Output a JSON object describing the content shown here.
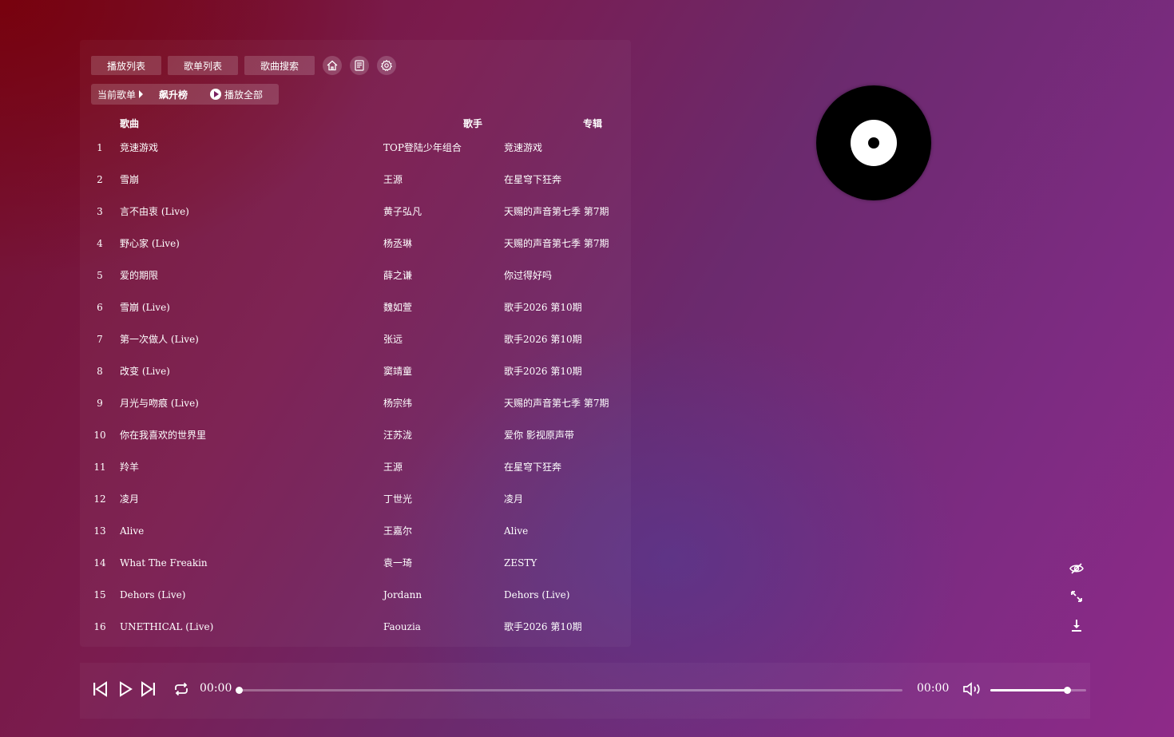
{
  "nav": {
    "tabs": [
      {
        "label": "播放列表",
        "icon": ""
      },
      {
        "label": "歌单列表",
        "icon": ""
      },
      {
        "label": "歌曲搜索",
        "icon": ""
      }
    ],
    "icon_buttons": [
      "home-icon",
      "document-icon",
      "settings-icon"
    ]
  },
  "subbar": {
    "current_label": "当前歌单",
    "list_name": "飙升榜",
    "play_all_label": "播放全部"
  },
  "table": {
    "headers": {
      "song": "歌曲",
      "artist": "歌手",
      "album": "专辑"
    },
    "rows": [
      {
        "num": "1",
        "song": "竞速游戏",
        "artist": "TOP登陆少年组合",
        "album": "竞速游戏"
      },
      {
        "num": "2",
        "song": "雪崩",
        "artist": "王源",
        "album": "在星穹下狂奔"
      },
      {
        "num": "3",
        "song": "言不由衷 (Live)",
        "artist": "黄子弘凡",
        "album": "天赐的声音第七季 第7期"
      },
      {
        "num": "4",
        "song": "野心家 (Live)",
        "artist": "杨丞琳",
        "album": "天赐的声音第七季 第7期"
      },
      {
        "num": "5",
        "song": "爱的期限",
        "artist": "薛之谦",
        "album": "你过得好吗"
      },
      {
        "num": "6",
        "song": "雪崩 (Live)",
        "artist": "魏如萱",
        "album": "歌手2026 第10期"
      },
      {
        "num": "7",
        "song": "第一次做人 (Live)",
        "artist": "张远",
        "album": "歌手2026 第10期"
      },
      {
        "num": "8",
        "song": "改变 (Live)",
        "artist": "窦靖童",
        "album": "歌手2026 第10期"
      },
      {
        "num": "9",
        "song": "月光与吻痕 (Live)",
        "artist": "杨宗纬",
        "album": "天赐的声音第七季 第7期"
      },
      {
        "num": "10",
        "song": "你在我喜欢的世界里",
        "artist": "汪苏泷",
        "album": "爱你 影视原声带"
      },
      {
        "num": "11",
        "song": "羚羊",
        "artist": "王源",
        "album": "在星穹下狂奔"
      },
      {
        "num": "12",
        "song": "凌月",
        "artist": "丁世光",
        "album": "凌月"
      },
      {
        "num": "13",
        "song": "Alive",
        "artist": "王嘉尔",
        "album": "Alive"
      },
      {
        "num": "14",
        "song": "What The Freakin",
        "artist": "袁一琦",
        "album": "ZESTY"
      },
      {
        "num": "15",
        "song": "Dehors (Live)",
        "artist": "Jordann",
        "album": "Dehors (Live)"
      },
      {
        "num": "16",
        "song": "UNETHICAL (Live)",
        "artist": "Faouzia",
        "album": "歌手2026 第10期"
      }
    ]
  },
  "side_icons": [
    "eye-off-icon",
    "fullscreen-icon",
    "download-icon"
  ],
  "player": {
    "current_time": "00:00",
    "total_time": "00:00",
    "progress_fraction": 0,
    "volume_fraction": 0.8
  },
  "colors": {
    "accent": "#ffffff",
    "bg_left": "#74102e",
    "bg_right": "#8e2a88"
  }
}
